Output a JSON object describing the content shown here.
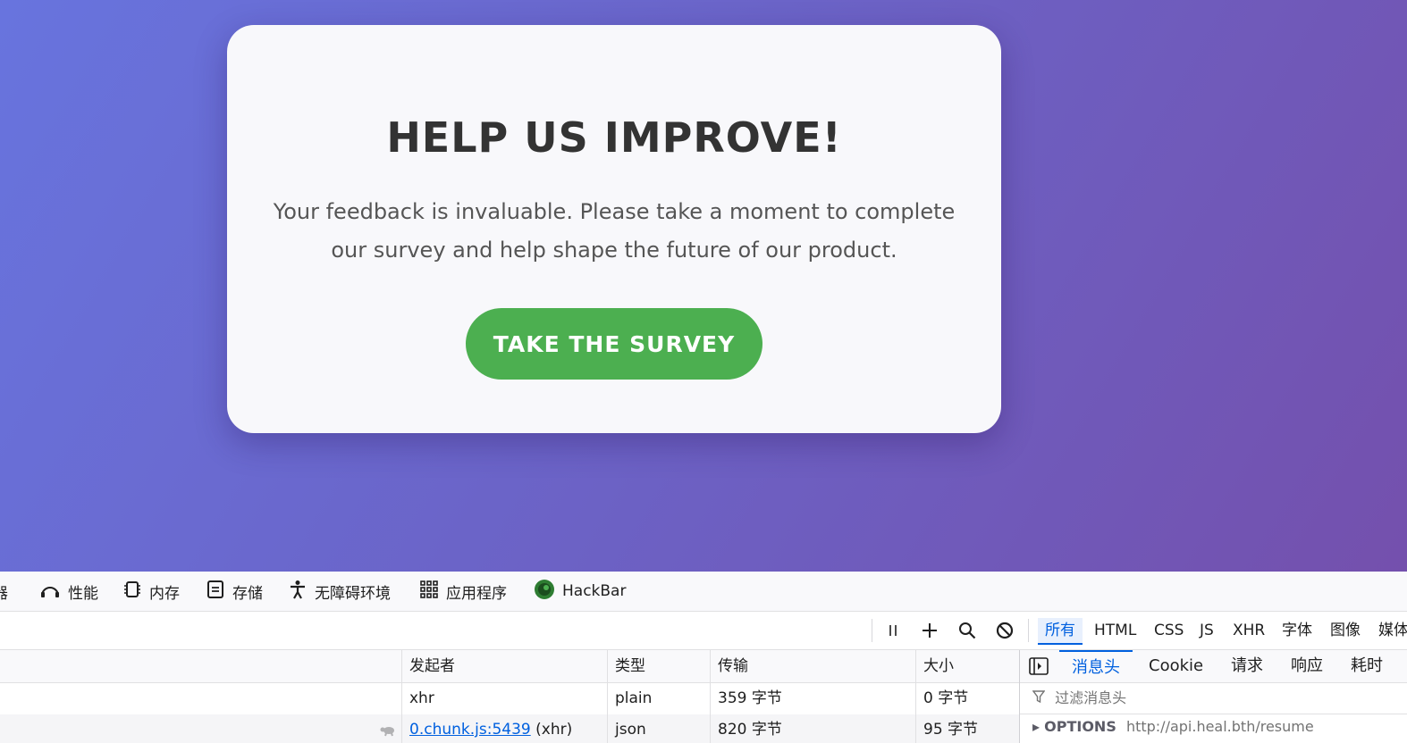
{
  "card": {
    "title": "HELP US IMPROVE!",
    "body": "Your feedback is invaluable. Please take a moment to complete our survey and help shape the future of our product.",
    "cta": "TAKE THE SURVEY"
  },
  "devtools": {
    "tabs": [
      {
        "label": "器",
        "icon": "partial-tab"
      },
      {
        "label": "性能",
        "icon": "performance-icon"
      },
      {
        "label": "内存",
        "icon": "memory-icon"
      },
      {
        "label": "存储",
        "icon": "storage-icon"
      },
      {
        "label": "无障碍环境",
        "icon": "accessibility-icon"
      },
      {
        "label": "应用程序",
        "icon": "application-icon"
      },
      {
        "label": "HackBar",
        "icon": "hackbar-icon"
      }
    ],
    "filters": [
      "所有",
      "HTML",
      "CSS",
      "JS",
      "XHR",
      "字体",
      "图像",
      "媒体"
    ],
    "columns": [
      "发起者",
      "类型",
      "传输",
      "大小"
    ],
    "rows": [
      {
        "initiator": "xhr",
        "initiator_link": "",
        "initiator_suffix": "",
        "type": "plain",
        "transfer": "359 字节",
        "size": "0 字节"
      },
      {
        "initiator": "",
        "initiator_link": "0.chunk.js:5439",
        "initiator_suffix": " (xhr)",
        "type": "json",
        "transfer": "820 字节",
        "size": "95 字节"
      }
    ],
    "side_tabs": [
      "消息头",
      "Cookie",
      "请求",
      "响应",
      "耗时"
    ],
    "filter_placeholder": "过滤消息头",
    "request_method": "OPTIONS",
    "request_url": "http://api.heal.bth/resume"
  }
}
